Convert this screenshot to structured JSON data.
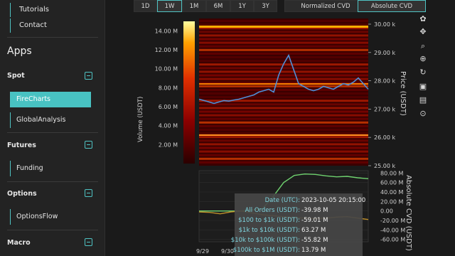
{
  "sidebar": {
    "links": [
      "Tutorials",
      "Contact"
    ],
    "apps_title": "Apps",
    "sections": [
      {
        "label": "Spot",
        "items": [
          "FireCharts",
          "GlobalAnalysis"
        ]
      },
      {
        "label": "Futures",
        "items": [
          "Funding"
        ]
      },
      {
        "label": "Options",
        "items": [
          "OptionsFlow"
        ]
      },
      {
        "label": "Macro",
        "items": []
      }
    ]
  },
  "toolbar": {
    "ranges": [
      "1D",
      "1W",
      "1M",
      "6M",
      "1Y",
      "3Y"
    ],
    "active_range": "1W",
    "cvd_modes": [
      "Normalized CVD",
      "Absolute CVD"
    ],
    "active_cvd": "Absolute CVD"
  },
  "chart_data": [
    {
      "type": "heatmap",
      "colorbar": {
        "label": "Volume (USDT)",
        "ticks": [
          "14.00 M",
          "12.00 M",
          "10.00 M",
          "8.00 M",
          "6.00 M",
          "4.00 M",
          "2.00 M"
        ],
        "range": [
          0,
          15
        ]
      },
      "y_right_label": "Price (USDT)",
      "y_right_ticks": [
        "30.00 k",
        "29.00 k",
        "28.00 k",
        "27.00 k",
        "26.00 k",
        "25.00 k"
      ],
      "ylim": [
        25000,
        30200
      ],
      "price_series": [
        27350,
        27300,
        27250,
        27200,
        27250,
        27300,
        27280,
        27320,
        27350,
        27400,
        27450,
        27500,
        27600,
        27650,
        27700,
        27600,
        28200,
        28600,
        28900,
        28400,
        27900,
        27800,
        27700,
        27650,
        27700,
        27800,
        27750,
        27700,
        27800,
        27900,
        27850,
        27950,
        28100,
        27900,
        27700
      ]
    },
    {
      "type": "line",
      "ylabel": "Absolute CVD (USDT)",
      "y_ticks": [
        "80.00 M",
        "60.00 M",
        "40.00 M",
        "20.00 M",
        "0.00",
        "-20.00 M",
        "-40.00 M",
        "-60.00 M"
      ],
      "ylim": [
        -65,
        85
      ],
      "x_ticks": [
        "9/29",
        "9/30"
      ],
      "series": [
        {
          "color": "#6fd26f",
          "values": [
            0,
            0,
            0,
            0,
            0,
            2,
            5,
            30,
            60,
            75,
            78,
            77,
            74,
            72,
            73,
            70,
            68
          ]
        },
        {
          "color": "#c0902a",
          "values": [
            -2,
            -3,
            -6,
            -2,
            0,
            -4,
            -8,
            -10,
            -12,
            -14,
            -15,
            -16,
            -15,
            -13,
            -12,
            -15,
            -18
          ]
        }
      ]
    }
  ],
  "tooltip": {
    "rows": [
      {
        "label": "Date (UTC):",
        "value": "2023-10-05 20:15:00"
      },
      {
        "label": "All Orders (USDT):",
        "value": "-39.98 M"
      },
      {
        "label": "$100 to $1k (USDT):",
        "value": "-59.01 M"
      },
      {
        "label": "$1k to $10k (USDT):",
        "value": "63.27 M"
      },
      {
        "label": "$10k to $100k (USDT):",
        "value": "-55.82 M"
      },
      {
        "label": "$100k to $1M (USDT):",
        "value": "13.79 M"
      }
    ]
  }
}
